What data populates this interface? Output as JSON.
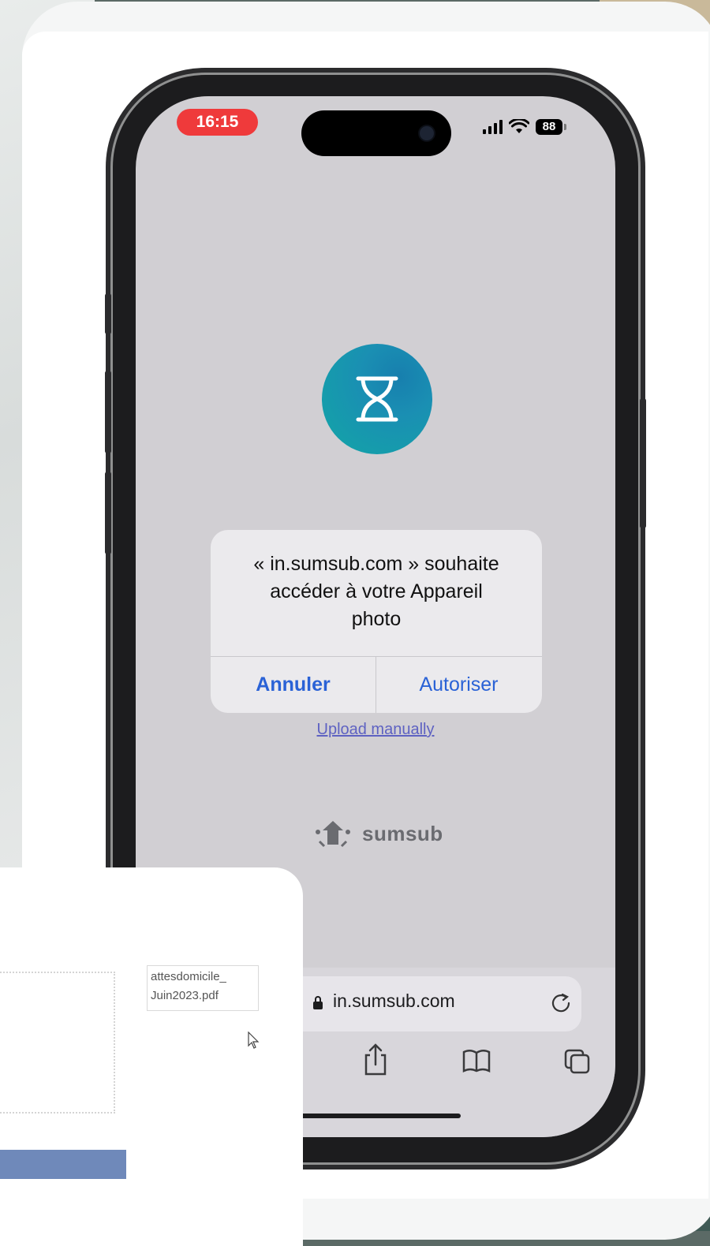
{
  "status_bar": {
    "time": "16:15",
    "battery": "88"
  },
  "permission_dialog": {
    "message": "« in.sumsub.com » souhaite\naccéder à votre Appareil\nphoto",
    "cancel_label": "Annuler",
    "allow_label": "Autoriser"
  },
  "upload_link": "Upload manually",
  "brand_name": "sumsub",
  "safari": {
    "url": "in.sumsub.com"
  },
  "file_preview": {
    "name": "attesdomicile_\nJuin2023.pdf"
  },
  "colors": {
    "accent_blue": "#2a62d6",
    "time_pill": "#ef3a3b",
    "logo_teal": "#12a6a6",
    "upload_bar": "#6f89ba"
  },
  "icons": [
    "hourglass-icon",
    "signal-icon",
    "wifi-icon",
    "battery-icon",
    "lock-icon",
    "reload-icon",
    "share-icon",
    "bookmarks-icon",
    "tabs-icon",
    "sumsub-logo-icon",
    "cursor-icon"
  ]
}
